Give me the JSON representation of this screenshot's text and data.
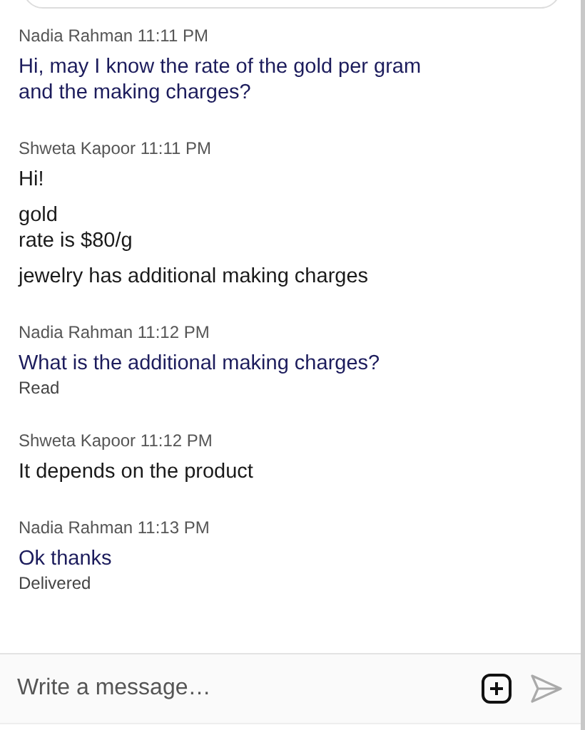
{
  "messages": [
    {
      "sender": "Nadia Rahman",
      "time": "11:11 PM",
      "kind": "outgoing",
      "paragraphs": [
        "Hi, may I know the rate of the gold per gram\nand the making charges?"
      ]
    },
    {
      "sender": "Shweta Kapoor",
      "time": "11:11 PM",
      "kind": "incoming",
      "paragraphs": [
        "Hi!",
        "gold\nrate is $80/g",
        "jewelry has additional making charges"
      ]
    },
    {
      "sender": "Nadia Rahman",
      "time": "11:12 PM",
      "kind": "outgoing",
      "paragraphs": [
        "What is the additional making charges?"
      ],
      "status": "Read"
    },
    {
      "sender": "Shweta Kapoor",
      "time": "11:12 PM",
      "kind": "incoming",
      "paragraphs": [
        "It depends on the product"
      ]
    },
    {
      "sender": "Nadia Rahman",
      "time": "11:13 PM",
      "kind": "outgoing",
      "paragraphs": [
        "Ok thanks"
      ],
      "status": "Delivered"
    }
  ],
  "composer": {
    "placeholder": "Write a message…"
  }
}
